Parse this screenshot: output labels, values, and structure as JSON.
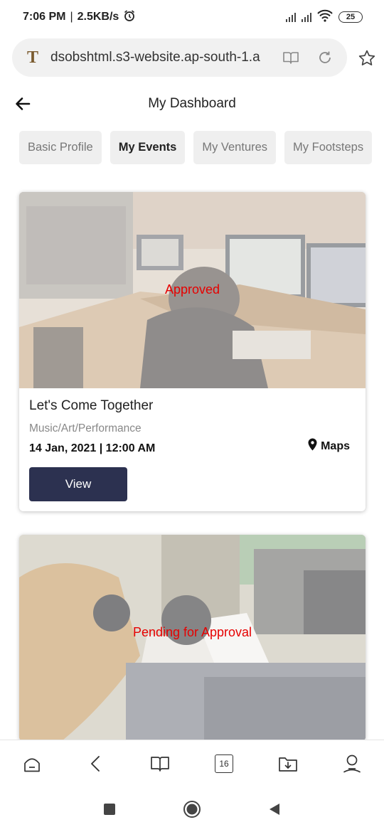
{
  "status_bar": {
    "time": "7:06 PM",
    "speed": "2.5KB/s",
    "battery": "25"
  },
  "browser": {
    "url": "dsobshtml.s3-website.ap-south-1.a",
    "site_icon_letter": "T",
    "tab_count": "16"
  },
  "header": {
    "title": "My Dashboard"
  },
  "tabs": [
    {
      "label": "Basic Profile",
      "active": false
    },
    {
      "label": "My Events",
      "active": true
    },
    {
      "label": "My Ventures",
      "active": false
    },
    {
      "label": "My Footsteps",
      "active": false
    }
  ],
  "events": [
    {
      "status": "Approved",
      "title": "Let's Come Together",
      "category": "Music/Art/Performance",
      "datetime": "14 Jan, 2021 | 12:00 AM",
      "maps_label": "Maps",
      "button_label": "View"
    },
    {
      "status": "Pending for Approval"
    }
  ],
  "colors": {
    "status_text": "#e60000",
    "button_bg": "#2c3150",
    "tab_bg": "#efefef"
  }
}
